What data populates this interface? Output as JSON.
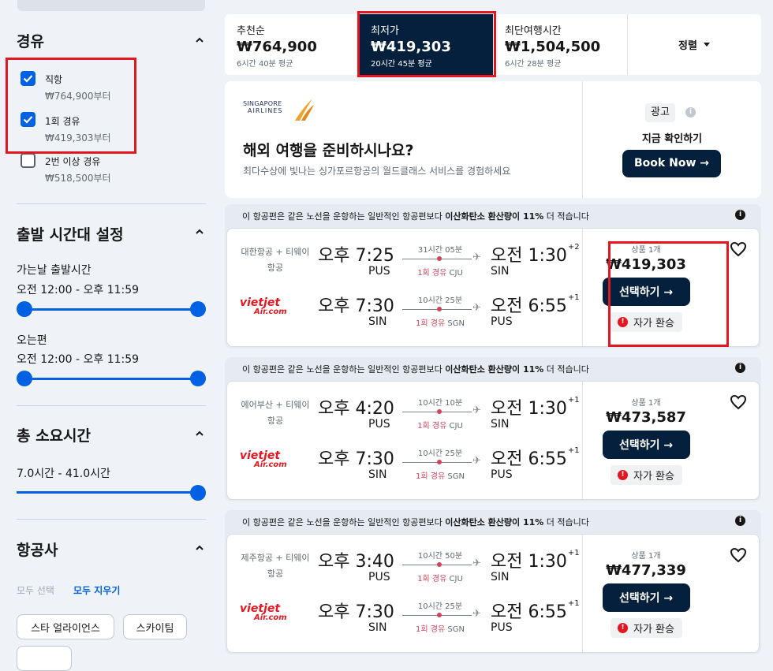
{
  "sidebar": {
    "stops": {
      "title": "경유",
      "options": [
        {
          "label": "직항",
          "price": "₩764,900부터",
          "checked": true
        },
        {
          "label": "1회 경유",
          "price": "₩419,303부터",
          "checked": true
        },
        {
          "label": "2번 이상 경유",
          "price": "₩518,500부터",
          "checked": false
        }
      ]
    },
    "departure_time": {
      "title": "출발 시간대 설정",
      "outbound_label": "가는날 출발시간",
      "outbound_range": "오전 12:00 - 오후 11:59",
      "return_label": "오는편",
      "return_range": "오전 12:00 - 오후 11:59"
    },
    "duration": {
      "title": "총 소요시간",
      "range": "7.0시간 - 41.0시간"
    },
    "airlines": {
      "title": "항공사",
      "select_all": "모두 선택",
      "clear_all": "모두 지우기",
      "alliances": [
        "스타 얼라이언스",
        "스카이팀"
      ]
    }
  },
  "sort_tabs": [
    {
      "title": "추천순",
      "price": "₩764,900",
      "sub": "6시간 40분 평균",
      "active": false
    },
    {
      "title": "최저가",
      "price": "₩419,303",
      "sub": "20시간 45분 평균",
      "active": true
    },
    {
      "title": "최단여행시간",
      "price": "₩1,504,500",
      "sub": "6시간 28분 평균",
      "active": false
    }
  ],
  "sort_button": "정렬",
  "ad": {
    "logo_top": "SINGAPORE",
    "logo_bottom": "AIRLINES",
    "headline": "해외 여행을 준비하시나요?",
    "body": "최다수상에 빛나는 싱가포르항공의 월드클래스 서비스를 경험하세요",
    "badge": "광고",
    "cta_caption": "지금 확인하기",
    "cta_button": "Book Now →"
  },
  "eco_notice": {
    "prefix": "이 항공편은 같은 노선을 운항하는 일반적인 항공편보다 ",
    "highlight": "이산화탄소 환산량이 11%",
    "suffix": " 더 적습니다"
  },
  "results": [
    {
      "carrier": "대한항공 + 티웨이항공",
      "outbound": {
        "dep": "오후 7:25",
        "dep_ap": "PUS",
        "duration": "31시간 05분",
        "stops": "1회 경유",
        "via": "CJU",
        "arr": "오전 1:30",
        "arr_offset": "+2",
        "arr_ap": "SIN"
      },
      "return": {
        "carrier_logo": "vietjet Air.com",
        "dep": "오후 7:30",
        "dep_ap": "SIN",
        "duration": "10시간 25분",
        "stops": "1회 경유",
        "via": "SGN",
        "arr": "오전 6:55",
        "arr_offset": "+1",
        "arr_ap": "PUS"
      },
      "deals": "상품 1개",
      "price": "₩419,303",
      "select": "선택하기 →",
      "tag": "자가 환승"
    },
    {
      "carrier": "에어부산 + 티웨이항공",
      "outbound": {
        "dep": "오후 4:20",
        "dep_ap": "PUS",
        "duration": "10시간 10분",
        "stops": "1회 경유",
        "via": "CJU",
        "arr": "오전 1:30",
        "arr_offset": "+1",
        "arr_ap": "SIN"
      },
      "return": {
        "carrier_logo": "vietjet Air.com",
        "dep": "오후 7:30",
        "dep_ap": "SIN",
        "duration": "10시간 25분",
        "stops": "1회 경유",
        "via": "SGN",
        "arr": "오전 6:55",
        "arr_offset": "+1",
        "arr_ap": "PUS"
      },
      "deals": "상품 1개",
      "price": "₩473,587",
      "select": "선택하기 →",
      "tag": "자가 환승"
    },
    {
      "carrier": "제주항공 + 티웨이항공",
      "outbound": {
        "dep": "오후 3:40",
        "dep_ap": "PUS",
        "duration": "10시간 50분",
        "stops": "1회 경유",
        "via": "CJU",
        "arr": "오전 1:30",
        "arr_offset": "+1",
        "arr_ap": "SIN"
      },
      "return": {
        "carrier_logo": "vietjet Air.com",
        "dep": "오후 7:30",
        "dep_ap": "SIN",
        "duration": "10시간 25분",
        "stops": "1회 경유",
        "via": "SGN",
        "arr": "오전 6:55",
        "arr_offset": "+1",
        "arr_ap": "PUS"
      },
      "deals": "상품 1개",
      "price": "₩477,339",
      "select": "선택하기 →",
      "tag": "자가 환승"
    }
  ],
  "colors": {
    "accent": "#0062e3",
    "navy": "#05203c",
    "highlight_box": "#e4161f",
    "stop_dot": "#d1435b"
  }
}
